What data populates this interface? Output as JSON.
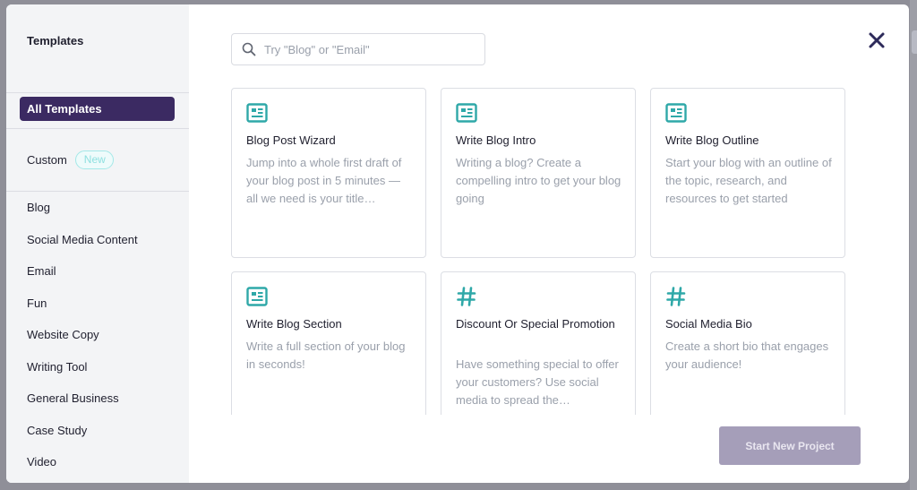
{
  "sidebar": {
    "title": "Templates",
    "all_templates": "All Templates",
    "custom": {
      "label": "Custom",
      "badge": "New"
    },
    "categories": [
      "Blog",
      "Social Media Content",
      "Email",
      "Fun",
      "Website Copy",
      "Writing Tool",
      "General Business",
      "Case Study",
      "Video"
    ]
  },
  "search": {
    "placeholder": "Try \"Blog\" or \"Email\"",
    "value": ""
  },
  "cards": [
    {
      "icon": "newspaper-icon",
      "title": "Blog Post Wizard",
      "description": "Jump into a whole first draft of your blog post in 5 minutes — all we need is your title…"
    },
    {
      "icon": "newspaper-icon",
      "title": "Write Blog Intro",
      "description": "Writing a blog? Create a compelling intro to get your blog going"
    },
    {
      "icon": "newspaper-icon",
      "title": "Write Blog Outline",
      "description": "Start your blog with an outline of the topic, research, and resources to get started"
    },
    {
      "icon": "newspaper-icon",
      "title": "Write Blog Section",
      "description": "Write a full section of your blog in seconds!"
    },
    {
      "icon": "hashtag-icon",
      "title": "Discount Or Special Promotion",
      "description": "Have something special to offer your customers? Use social media to spread the…"
    },
    {
      "icon": "hashtag-icon",
      "title": "Social Media Bio",
      "description": "Create a short bio that engages your audience!"
    }
  ],
  "footer": {
    "start_button": "Start New Project"
  },
  "colors": {
    "accent": "#3b2a62",
    "icon_teal": "#2fa8a8",
    "disabled_button": "#a59eb9",
    "badge_teal": "#8fe0e0"
  }
}
